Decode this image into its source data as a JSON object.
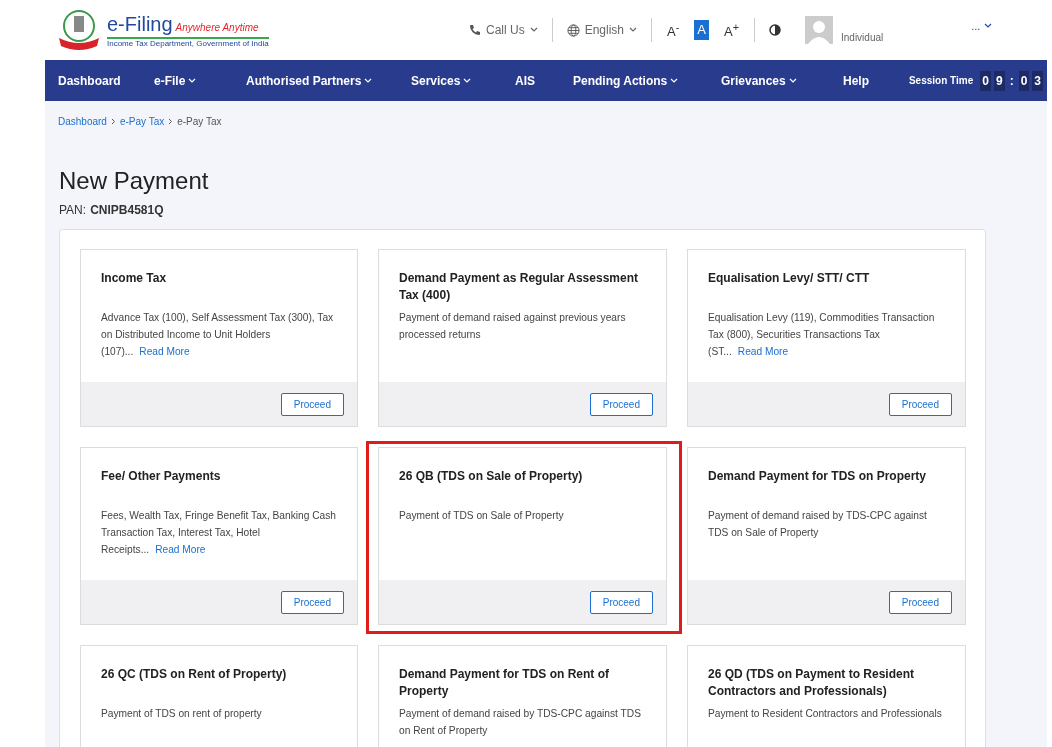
{
  "header": {
    "logo_title": "e-Filing",
    "logo_tagline": "Anywhere Anytime",
    "logo_subtitle": "Income Tax Department, Government of India",
    "call_us": "Call Us",
    "language": "English",
    "font_controls": [
      {
        "label": "A",
        "sup": "-",
        "selected": false
      },
      {
        "label": "A",
        "selected": true
      },
      {
        "label": "A",
        "sup": "+",
        "selected": false
      }
    ],
    "user_role": "Individual",
    "user_name": "..."
  },
  "nav": {
    "items": [
      {
        "label": "Dashboard",
        "dropdown": false
      },
      {
        "label": "e-File",
        "dropdown": true
      },
      {
        "label": "Authorised Partners",
        "dropdown": true
      },
      {
        "label": "Services",
        "dropdown": true
      },
      {
        "label": "AIS",
        "dropdown": false
      },
      {
        "label": "Pending Actions",
        "dropdown": true
      },
      {
        "label": "Grievances",
        "dropdown": true
      },
      {
        "label": "Help",
        "dropdown": false
      }
    ],
    "session_label": "Session Time",
    "session_digits": [
      "0",
      "9",
      ":",
      "0",
      "3"
    ]
  },
  "breadcrumb": [
    {
      "label": "Dashboard",
      "link": true
    },
    {
      "label": "e-Pay Tax",
      "link": true
    },
    {
      "label": "e-Pay Tax",
      "link": false
    }
  ],
  "page": {
    "title": "New Payment",
    "pan_label": "PAN:",
    "pan": "CNIPB4581Q"
  },
  "cards": [
    {
      "title": "Income Tax",
      "description": "Advance Tax (100), Self Assessment Tax (300), Tax on Distributed Income to Unit Holders (107)...",
      "read_more": "Read More",
      "button": "Proceed",
      "highlighted": false
    },
    {
      "title": "Demand Payment as Regular Assessment Tax (400)",
      "description": "Payment of demand raised against previous years processed returns",
      "button": "Proceed",
      "highlighted": false
    },
    {
      "title": "Equalisation Levy/ STT/ CTT",
      "description": "Equalisation Levy (119), Commodities Transaction Tax (800), Securities Transactions Tax (ST...",
      "read_more": "Read More",
      "button": "Proceed",
      "highlighted": false
    },
    {
      "title": "Fee/ Other Payments",
      "description": "Fees, Wealth Tax, Fringe Benefit Tax, Banking Cash Transaction Tax, Interest Tax, Hotel Receipts...",
      "read_more": "Read More",
      "button": "Proceed",
      "highlighted": false
    },
    {
      "title": "26 QB (TDS on Sale of Property)",
      "description": "Payment of TDS on Sale of Property",
      "button": "Proceed",
      "highlighted": true
    },
    {
      "title": "Demand Payment for TDS on Property",
      "description": "Payment of demand raised by TDS-CPC against TDS on Sale of Property",
      "button": "Proceed",
      "highlighted": false
    },
    {
      "title": "26 QC (TDS on Rent of Property)",
      "description": "Payment of TDS on rent of property",
      "highlighted": false
    },
    {
      "title": "Demand Payment for TDS on Rent of Property",
      "description": "Payment of demand raised by TDS-CPC against TDS on Rent of Property",
      "highlighted": false
    },
    {
      "title": "26 QD (TDS on Payment to Resident Contractors and Professionals)",
      "description": "Payment to Resident Contractors and Professionals",
      "highlighted": false
    }
  ]
}
